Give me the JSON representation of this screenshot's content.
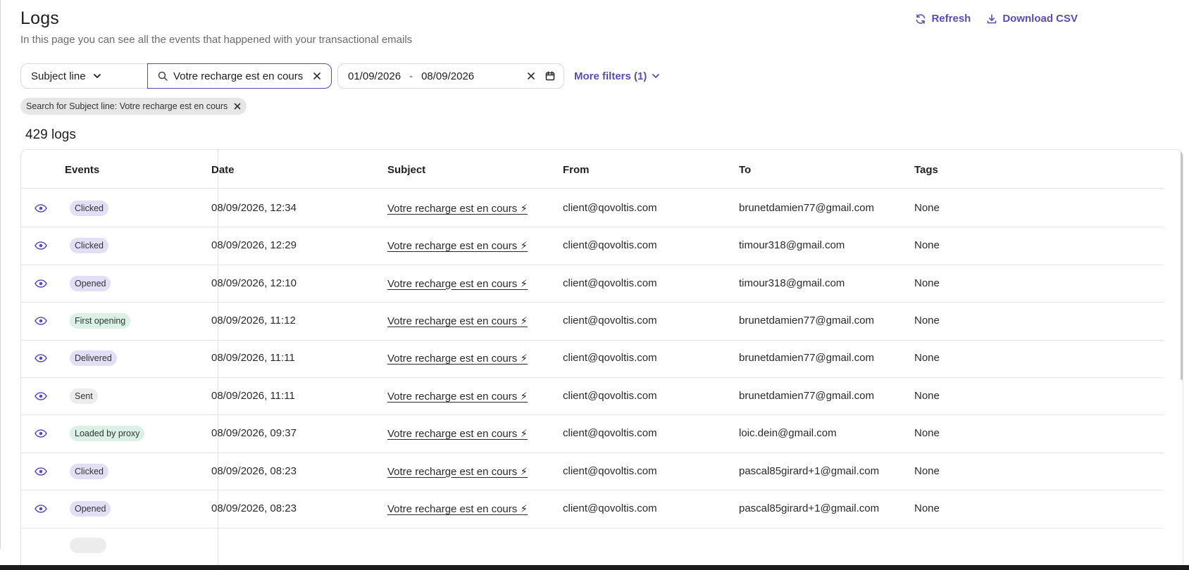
{
  "header": {
    "title": "Logs",
    "description": "In this page you can see all the events that happened with your transactional emails",
    "refresh_label": "Refresh",
    "download_label": "Download CSV"
  },
  "filters": {
    "field_select": "Subject line",
    "search_value": "Votre recharge est en cours",
    "date_from": "01/09/2026",
    "date_sep": "-",
    "date_to": "08/09/2026",
    "more_filters_label": "More filters (1)"
  },
  "active_chip": "Search for Subject line: Votre recharge est en cours",
  "count_label": "429 logs",
  "table": {
    "columns": [
      "Events",
      "Date",
      "Subject",
      "From",
      "To",
      "Tags"
    ],
    "rows": [
      {
        "event": "Clicked",
        "event_style": "purple",
        "date": "08/09/2026, 12:34",
        "subject": "Votre recharge est en cours ⚡",
        "from": "client@qovoltis.com",
        "to": "brunetdamien77@gmail.com",
        "tags": "None"
      },
      {
        "event": "Clicked",
        "event_style": "purple",
        "date": "08/09/2026, 12:29",
        "subject": "Votre recharge est en cours ⚡",
        "from": "client@qovoltis.com",
        "to": "timour318@gmail.com",
        "tags": "None"
      },
      {
        "event": "Opened",
        "event_style": "purple",
        "date": "08/09/2026, 12:10",
        "subject": "Votre recharge est en cours ⚡",
        "from": "client@qovoltis.com",
        "to": "timour318@gmail.com",
        "tags": "None"
      },
      {
        "event": "First opening",
        "event_style": "green",
        "date": "08/09/2026, 11:12",
        "subject": "Votre recharge est en cours ⚡",
        "from": "client@qovoltis.com",
        "to": "brunetdamien77@gmail.com",
        "tags": "None"
      },
      {
        "event": "Delivered",
        "event_style": "purple",
        "date": "08/09/2026, 11:11",
        "subject": "Votre recharge est en cours ⚡",
        "from": "client@qovoltis.com",
        "to": "brunetdamien77@gmail.com",
        "tags": "None"
      },
      {
        "event": "Sent",
        "event_style": "grey",
        "date": "08/09/2026, 11:11",
        "subject": "Votre recharge est en cours ⚡",
        "from": "client@qovoltis.com",
        "to": "brunetdamien77@gmail.com",
        "tags": "None"
      },
      {
        "event": "Loaded by proxy",
        "event_style": "green",
        "date": "08/09/2026, 09:37",
        "subject": "Votre recharge est en cours ⚡",
        "from": "client@qovoltis.com",
        "to": "loic.dein@gmail.com",
        "tags": "None"
      },
      {
        "event": "Clicked",
        "event_style": "purple",
        "date": "08/09/2026, 08:23",
        "subject": "Votre recharge est en cours ⚡",
        "from": "client@qovoltis.com",
        "to": "pascal85girard+1@gmail.com",
        "tags": "None"
      },
      {
        "event": "Opened",
        "event_style": "purple",
        "date": "08/09/2026, 08:23",
        "subject": "Votre recharge est en cours ⚡",
        "from": "client@qovoltis.com",
        "to": "pascal85girard+1@gmail.com",
        "tags": "None"
      }
    ]
  },
  "colors": {
    "accent": "#5b4bb7",
    "badge_purple": "#e2def5",
    "badge_green": "#d9f1e6",
    "badge_grey": "#ececec"
  },
  "icons": {
    "refresh": "refresh-icon",
    "download": "download-icon",
    "chevron": "chevron-down-icon",
    "search": "search-icon",
    "clear": "close-icon",
    "calendar": "calendar-icon",
    "view": "eye-icon"
  }
}
